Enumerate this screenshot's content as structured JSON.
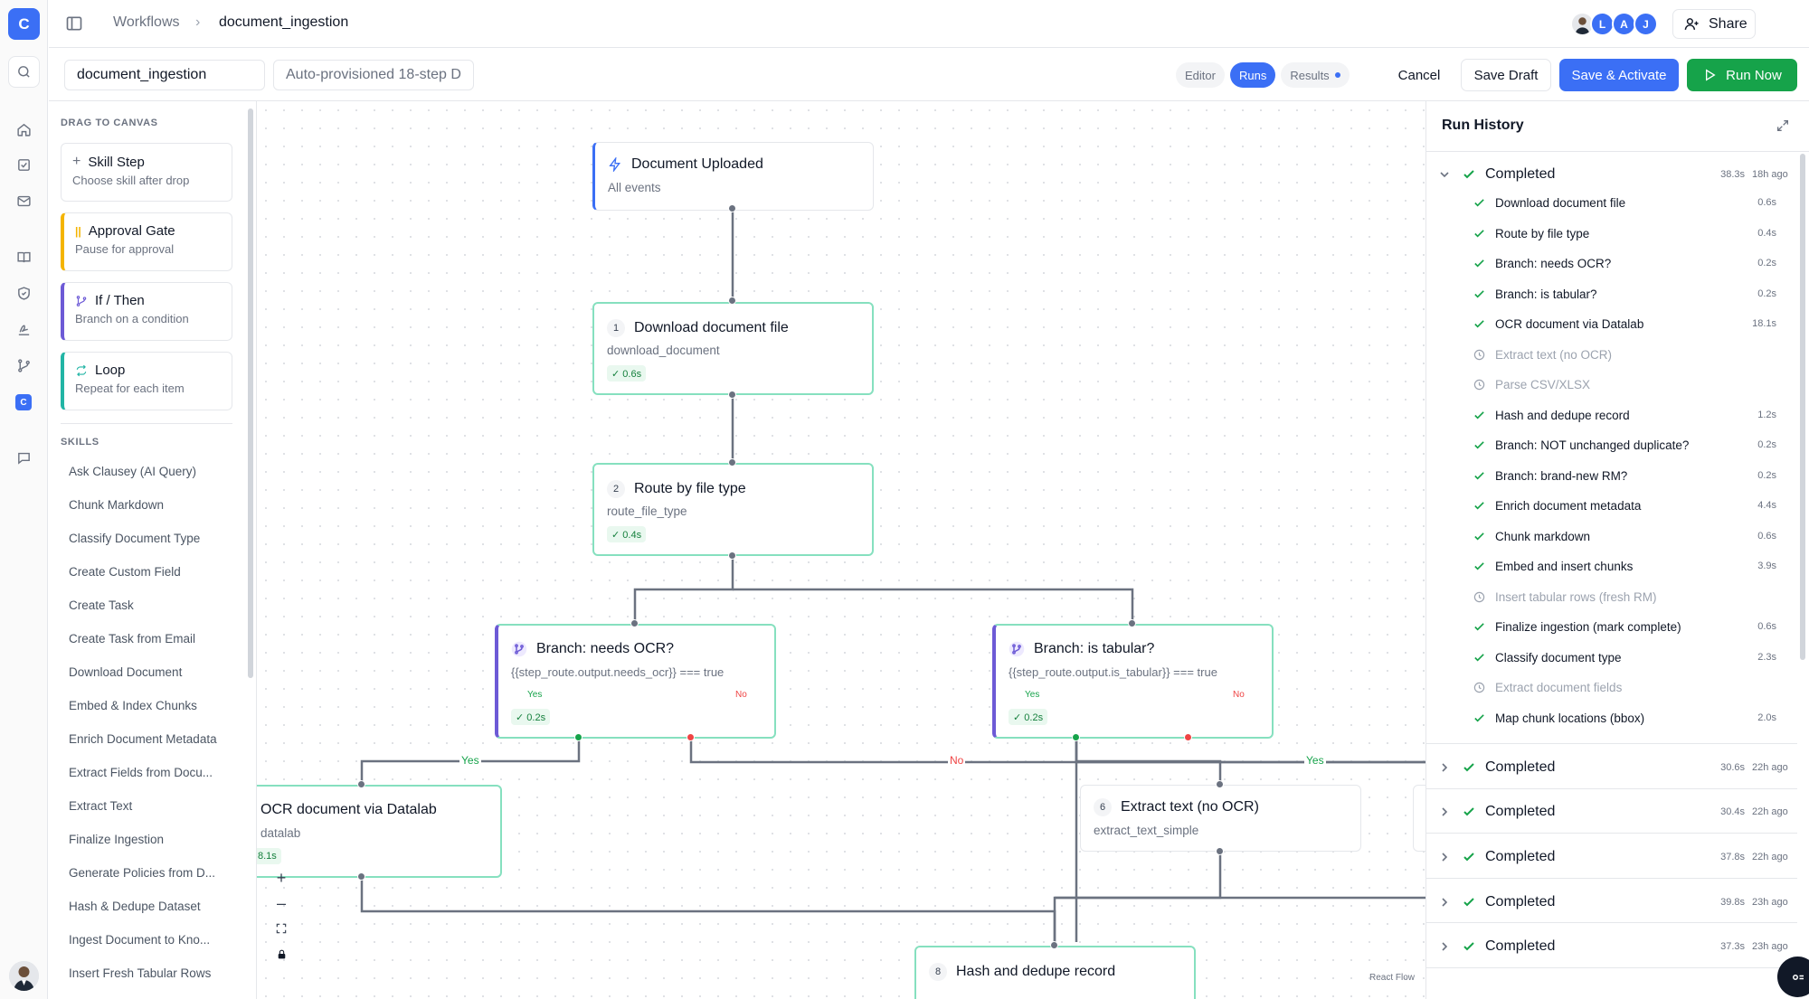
{
  "app": {
    "logo_letter": "C",
    "workspace_letter": "C"
  },
  "breadcrumb": {
    "root": "Workflows",
    "separator": "›",
    "current": "document_ingestion"
  },
  "header": {
    "collaborators": [
      "L",
      "A",
      "J"
    ],
    "collaborator_colors": [
      "#3b6ff5",
      "#3b6ff5",
      "#3b6ff5"
    ],
    "share_label": "Share"
  },
  "toolbar": {
    "workflow_name": "document_ingestion",
    "description": "Auto-provisioned 18-step D",
    "tabs": [
      {
        "label": "Editor",
        "active": false
      },
      {
        "label": "Runs",
        "active": true
      },
      {
        "label": "Results",
        "active": false
      }
    ],
    "cancel_label": "Cancel",
    "save_draft_label": "Save Draft",
    "save_activate_label": "Save & Activate",
    "run_now_label": "Run Now"
  },
  "palette": {
    "drag_heading": "DRAG TO CANVAS",
    "blocks": [
      {
        "title": "Skill Step",
        "subtitle": "Choose skill after drop",
        "icon": "plus-icon"
      },
      {
        "title": "Approval Gate",
        "subtitle": "Pause for approval",
        "icon": "pause-icon"
      },
      {
        "title": "If / Then",
        "subtitle": "Branch on a condition",
        "icon": "branch-icon"
      },
      {
        "title": "Loop",
        "subtitle": "Repeat for each item",
        "icon": "loop-icon"
      }
    ],
    "skills_heading": "SKILLS",
    "skills": [
      "Ask Clausey (AI Query)",
      "Chunk Markdown",
      "Classify Document Type",
      "Create Custom Field",
      "Create Task",
      "Create Task from Email",
      "Download Document",
      "Embed & Index Chunks",
      "Enrich Document Metadata",
      "Extract Fields from Docu...",
      "Extract Text",
      "Finalize Ingestion",
      "Generate Policies from D...",
      "Hash & Dedupe Dataset",
      "Ingest Document to Kno...",
      "Insert Fresh Tabular Rows"
    ]
  },
  "canvas": {
    "nodes": {
      "trigger": {
        "title": "Document Uploaded",
        "subtitle": "All events"
      },
      "download": {
        "num": "1",
        "title": "Download document file",
        "subtitle": "download_document",
        "badge": "✓ 0.6s"
      },
      "route": {
        "num": "2",
        "title": "Route by file type",
        "subtitle": "route_file_type",
        "badge": "✓ 0.4s"
      },
      "needs_ocr": {
        "title": "Branch: needs OCR?",
        "condition": "{{step_route.output.needs_ocr}} === true",
        "yes": "Yes",
        "no": "No",
        "badge": "✓ 0.2s"
      },
      "is_tabular": {
        "title": "Branch: is tabular?",
        "condition": "{{step_route.output.is_tabular}} === true",
        "yes": "Yes",
        "no": "No",
        "badge": "✓ 0.2s"
      },
      "ocr": {
        "title": "OCR document via Datalab",
        "subtitle": "datalab",
        "badge": "8.1s"
      },
      "extract_text": {
        "num": "6",
        "title": "Extract text (no OCR)",
        "subtitle": "extract_text_simple"
      },
      "hash": {
        "num": "8",
        "title": "Hash and dedupe record"
      }
    },
    "edge_labels": {
      "ocr_yes": "Yes",
      "ocr_no": "No",
      "tabular_yes": "Yes"
    },
    "attribution": "React Flow"
  },
  "history": {
    "title": "Run History",
    "runs": [
      {
        "status": "Completed",
        "duration": "38.3s",
        "ago": "18h ago",
        "expanded": true,
        "steps": [
          {
            "label": "Download document file",
            "duration": "0.6s",
            "status": "done"
          },
          {
            "label": "Route by file type",
            "duration": "0.4s",
            "status": "done"
          },
          {
            "label": "Branch: needs OCR?",
            "duration": "0.2s",
            "status": "done"
          },
          {
            "label": "Branch: is tabular?",
            "duration": "0.2s",
            "status": "done"
          },
          {
            "label": "OCR document via Datalab",
            "duration": "18.1s",
            "status": "done"
          },
          {
            "label": "Extract text (no OCR)",
            "duration": "",
            "status": "skipped"
          },
          {
            "label": "Parse CSV/XLSX",
            "duration": "",
            "status": "skipped"
          },
          {
            "label": "Hash and dedupe record",
            "duration": "1.2s",
            "status": "done"
          },
          {
            "label": "Branch: NOT unchanged duplicate?",
            "duration": "0.2s",
            "status": "done"
          },
          {
            "label": "Branch: brand-new RM?",
            "duration": "0.2s",
            "status": "done"
          },
          {
            "label": "Enrich document metadata",
            "duration": "4.4s",
            "status": "done"
          },
          {
            "label": "Chunk markdown",
            "duration": "0.6s",
            "status": "done"
          },
          {
            "label": "Embed and insert chunks",
            "duration": "3.9s",
            "status": "done"
          },
          {
            "label": "Insert tabular rows (fresh RM)",
            "duration": "",
            "status": "skipped"
          },
          {
            "label": "Finalize ingestion (mark complete)",
            "duration": "0.6s",
            "status": "done"
          },
          {
            "label": "Classify document type",
            "duration": "2.3s",
            "status": "done"
          },
          {
            "label": "Extract document fields",
            "duration": "",
            "status": "skipped"
          },
          {
            "label": "Map chunk locations (bbox)",
            "duration": "2.0s",
            "status": "done"
          }
        ]
      },
      {
        "status": "Completed",
        "duration": "30.6s",
        "ago": "22h ago",
        "expanded": false
      },
      {
        "status": "Completed",
        "duration": "30.4s",
        "ago": "22h ago",
        "expanded": false
      },
      {
        "status": "Completed",
        "duration": "37.8s",
        "ago": "22h ago",
        "expanded": false
      },
      {
        "status": "Completed",
        "duration": "39.8s",
        "ago": "23h ago",
        "expanded": false
      },
      {
        "status": "Completed",
        "duration": "37.3s",
        "ago": "23h ago",
        "expanded": false
      }
    ]
  },
  "colors": {
    "accent": "#3b6ff5",
    "success": "#16a34a",
    "danger": "#ef4444",
    "node_border": "#86e0bf",
    "branch_accent": "#6d5ad6"
  }
}
